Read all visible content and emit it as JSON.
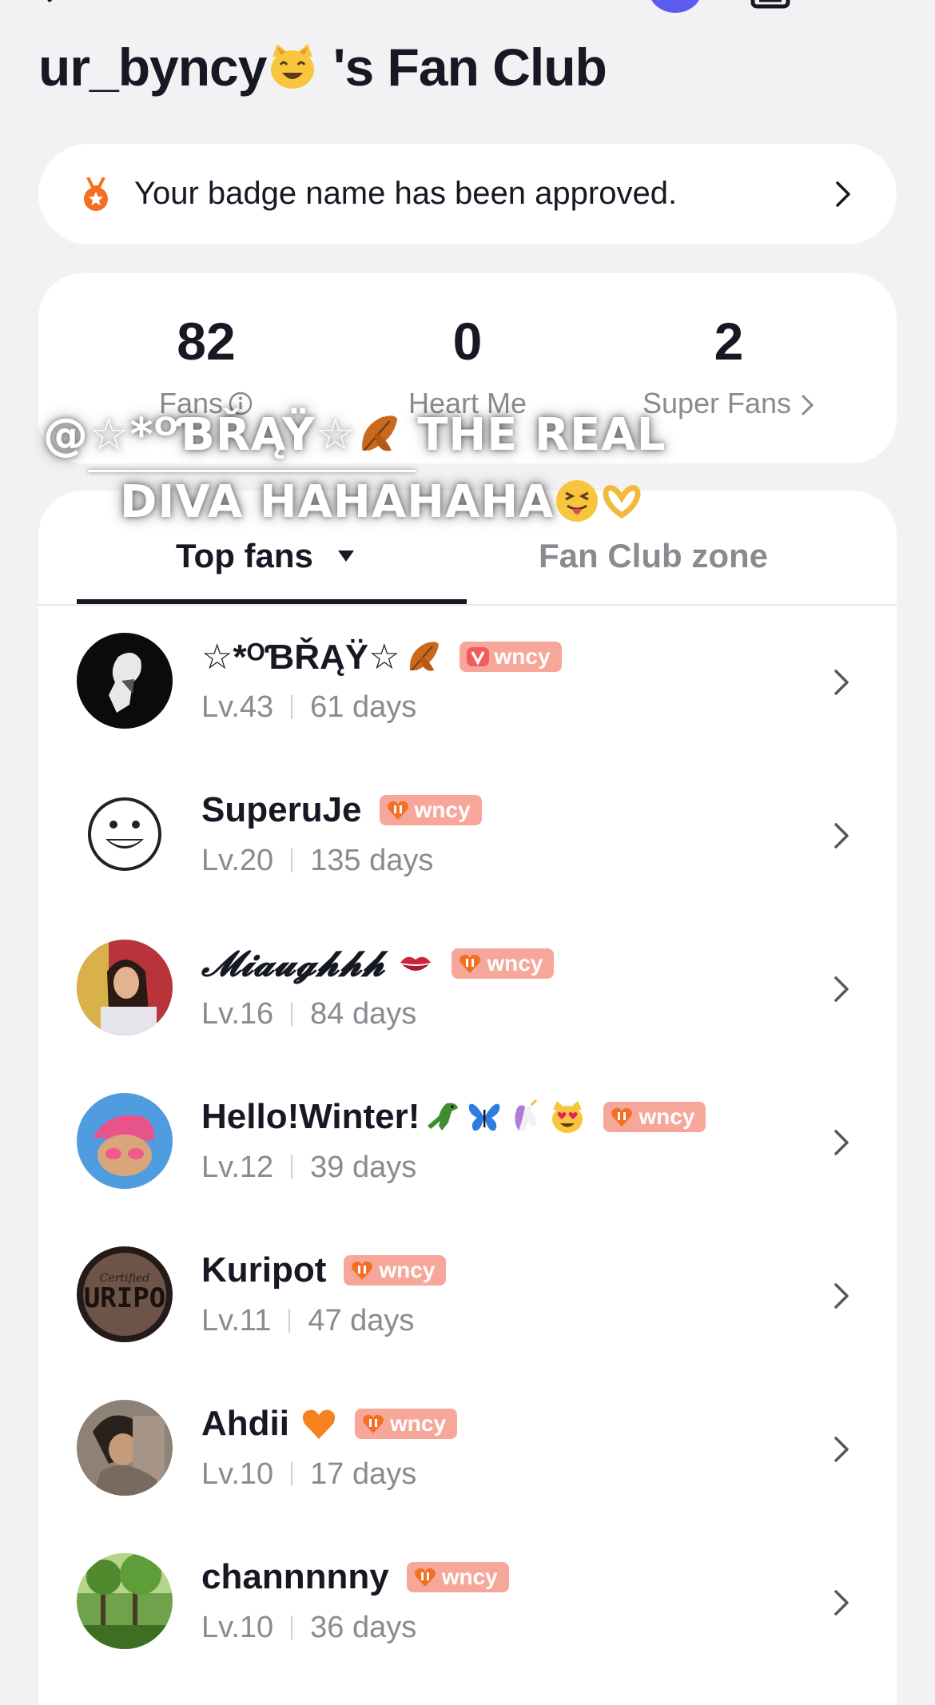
{
  "header": {
    "title_prefix": "ur_byncy",
    "title_suffix": " 's Fan Club"
  },
  "notice": {
    "text": "Your badge name has been approved."
  },
  "stats": [
    {
      "value": "82",
      "label": "Fans"
    },
    {
      "value": "0",
      "label": "Heart Me"
    },
    {
      "value": "2",
      "label": "Super Fans"
    }
  ],
  "tabs": {
    "top_fans": "Top fans",
    "fan_club_zone": "Fan Club zone"
  },
  "overlay": {
    "line1": "@☆*ᴼƁŘĄŸ☆",
    "line1_rest": " THE REAL",
    "line2": "DIVA HAHAHAHA"
  },
  "fans": [
    {
      "name": "☆*ᴼƁŘĄŸ☆",
      "badge": "wncy",
      "level": "Lv.43",
      "days": "61 days",
      "badge_style": "v"
    },
    {
      "name": "SuperuJe",
      "badge": "wncy",
      "level": "Lv.20",
      "days": "135 days",
      "badge_style": "heart"
    },
    {
      "name": "𝓜𝓲𝓪𝓾𝓰𝓱𝓱𝓱",
      "badge": "wncy",
      "level": "Lv.16",
      "days": "84 days",
      "badge_style": "heart"
    },
    {
      "name": "Hello!Winter!",
      "badge": "wncy",
      "level": "Lv.12",
      "days": "39 days",
      "badge_style": "heart"
    },
    {
      "name": "Kuripot",
      "badge": "wncy",
      "level": "Lv.11",
      "days": "47 days",
      "badge_style": "heart"
    },
    {
      "name": "Ahdii",
      "badge": "wncy",
      "level": "Lv.10",
      "days": "17 days",
      "badge_style": "heart"
    },
    {
      "name": "channnnny",
      "badge": "wncy",
      "level": "Lv.10",
      "days": "36 days",
      "badge_style": "heart"
    }
  ],
  "colors": {
    "badge": "#f7a79a",
    "badge_v": "#f35b5b",
    "accent_dot": "#5b5bf0",
    "text_primary": "#161823",
    "text_secondary": "#8a8b91"
  }
}
